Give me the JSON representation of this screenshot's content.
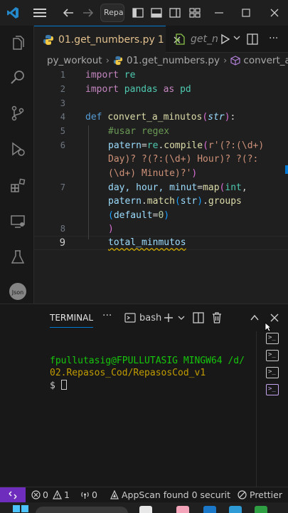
{
  "titlebar": {
    "search_text": "Repasos",
    "icons": [
      "vscode-logo-icon",
      "menu-icon",
      "back-arrow-icon",
      "forward-arrow-icon",
      "toggle-sidebar-icon",
      "toggle-panel-icon",
      "toggle-secondary-sidebar-icon",
      "layout-icon",
      "minimize-icon",
      "maximize-icon",
      "close-icon"
    ]
  },
  "activity_bar": [
    "explorer-icon",
    "search-icon",
    "source-control-icon",
    "run-debug-icon",
    "extensions-icon",
    "remote-explorer-icon",
    "testing-icon",
    "json-icon",
    "gitlens-icon",
    "accounts-icon",
    "settings-gear-icon"
  ],
  "tabs": [
    {
      "label": "01.get_numbers.py",
      "badge": "1",
      "active": true
    },
    {
      "label": "get_n",
      "active": false
    }
  ],
  "breadcrumb": {
    "folder": "py_workout",
    "file": "01.get_numbers.py",
    "symbol": "convert_a_min"
  },
  "editor": {
    "line_numbers": [
      "1",
      "2",
      "3",
      "4",
      "5",
      "6",
      "",
      "",
      "7",
      "",
      "",
      "8",
      "9"
    ],
    "current_line": "9",
    "lines": {
      "l1_kw": "import",
      "l1_mod": " re",
      "l2_kw": "import",
      "l2_mod": " pandas ",
      "l2_as": "as",
      "l2_alias": " pd",
      "l4_def": "def",
      "l4_fn": "convert_a_minutos",
      "l4_p1": "(",
      "l4_param": "str",
      "l4_p2": ")",
      "l4_colon": ":",
      "l5_comment": "#usar regex",
      "l6_var": "patern",
      "l6_eq": "=",
      "l6_mod": "re",
      "l6_dot": ".",
      "l6_fn": "compile",
      "l6_p": "(",
      "l6_r": "r'(?:(\\d+)",
      "l6b": "Day)? ?(?:(\\d+) Hour)? ?(?:",
      "l6c": "(\\d+) Minute)?'",
      "l6c_p": ")",
      "l7_vars": "day, hour, minut",
      "l7_eq": "=",
      "l7_fn": "map",
      "l7_p": "(",
      "l7_ty": "int",
      "l7_comma": ",",
      "l7b_var": "patern",
      "l7b_dot": ".",
      "l7b_fn": "match",
      "l7b_p1": "(",
      "l7b_arg": "str",
      "l7b_p2": ")",
      "l7b_dot2": ".",
      "l7b_fn2": "groups",
      "l7c_p1": "(",
      "l7c_kw": "default",
      "l7c_eq": "=",
      "l7c_num": "0",
      "l7c_p2": ")",
      "l8_p": ")",
      "l9_var": "total_minmutos"
    }
  },
  "panel": {
    "tab_label": "TERMINAL",
    "more": "···",
    "shell": "bash",
    "terminal_lines": {
      "prompt_user": "fpullutasig@FPULLUTASIG MINGW64 /d/",
      "prompt_path": "02.Repasos_Cod/RepasosCod_v1",
      "prompt": "$ "
    }
  },
  "statusbar": {
    "errors": "0",
    "warnings": "1",
    "ports": "0",
    "appscan": "AppScan found 0 securit",
    "prettier": "Prettier"
  },
  "colors": {
    "accent": "#0078d4",
    "remote": "#6f2dbd",
    "modified_tab": "#e2c08d"
  }
}
